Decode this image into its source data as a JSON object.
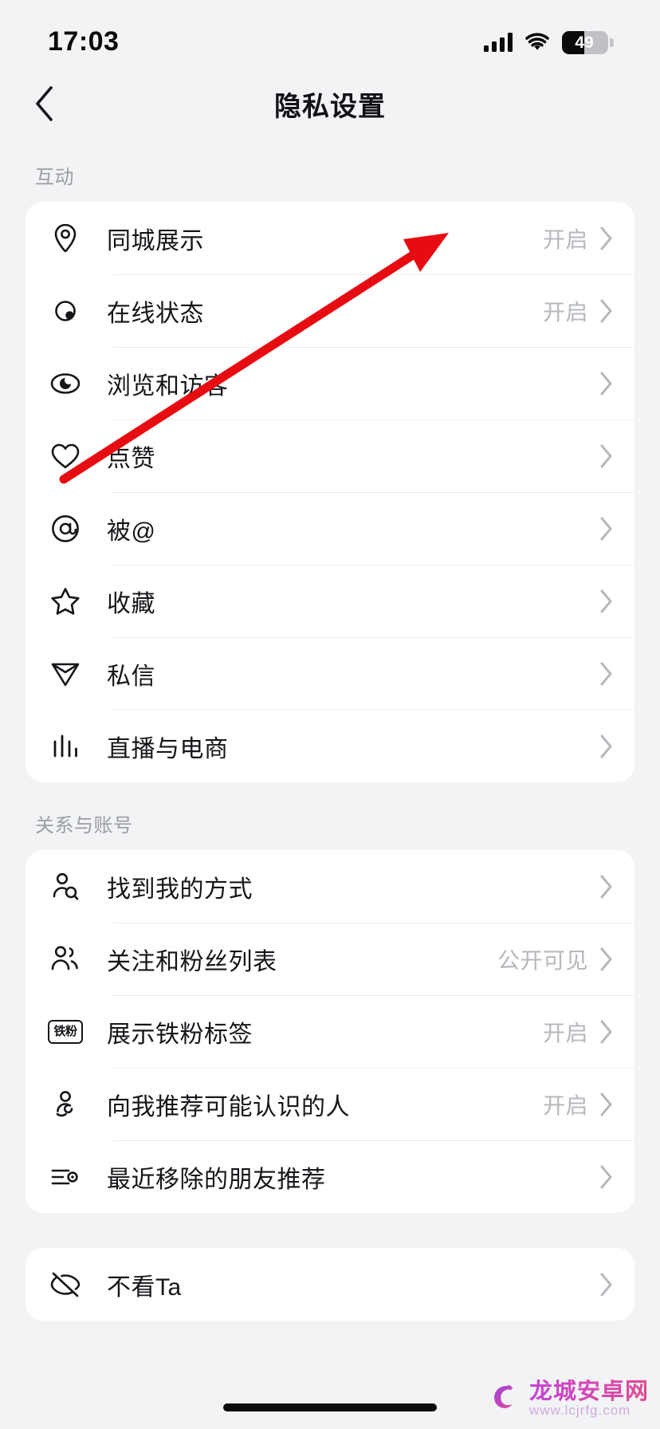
{
  "status_bar": {
    "time": "17:03",
    "battery_percent": "49",
    "battery_level": 49,
    "signal_icon": "cellular-signal-icon",
    "wifi_icon": "wifi-icon",
    "battery_icon": "battery-icon"
  },
  "nav": {
    "title": "隐私设置",
    "back_icon": "chevron-left-icon"
  },
  "sections": [
    {
      "header": "互动",
      "rows": [
        {
          "icon": "location-pin-icon",
          "label": "同城展示",
          "value": "开启"
        },
        {
          "icon": "online-status-icon",
          "label": "在线状态",
          "value": "开启"
        },
        {
          "icon": "eye-icon",
          "label": "浏览和访客",
          "value": ""
        },
        {
          "icon": "heart-icon",
          "label": "点赞",
          "value": ""
        },
        {
          "icon": "at-sign-icon",
          "label": "被@",
          "value": ""
        },
        {
          "icon": "star-icon",
          "label": "收藏",
          "value": ""
        },
        {
          "icon": "send-message-icon",
          "label": "私信",
          "value": ""
        },
        {
          "icon": "bar-chart-icon",
          "label": "直播与电商",
          "value": ""
        }
      ]
    },
    {
      "header": "关系与账号",
      "rows": [
        {
          "icon": "person-search-icon",
          "label": "找到我的方式",
          "value": ""
        },
        {
          "icon": "people-group-icon",
          "label": "关注和粉丝列表",
          "value": "公开可见"
        },
        {
          "icon": "iron-fan-badge-icon",
          "label": "展示铁粉标签",
          "value": "开启",
          "badge_text": "铁粉"
        },
        {
          "icon": "person-suggest-icon",
          "label": "向我推荐可能认识的人",
          "value": "开启"
        },
        {
          "icon": "list-remove-icon",
          "label": "最近移除的朋友推荐",
          "value": ""
        }
      ]
    },
    {
      "header": "",
      "rows": [
        {
          "icon": "eye-off-icon",
          "label": "不看Ta",
          "value": ""
        }
      ]
    }
  ],
  "annotation": {
    "arrow_color": "#e60c11",
    "arrow_from": "78,602",
    "arrow_to": "560,293"
  },
  "watermark": {
    "title": "龙城安卓网",
    "url": "www.lcjrfg.com",
    "logo_icon": "dragon-logo-icon"
  },
  "chevron_icon": "chevron-right-icon",
  "home_indicator_icon": "home-indicator"
}
